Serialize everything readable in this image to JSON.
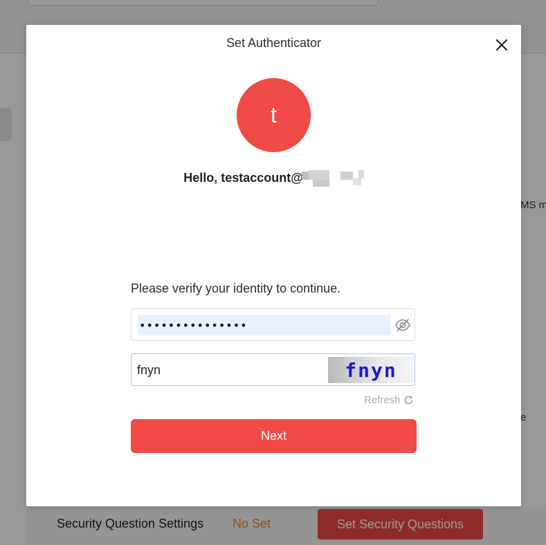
{
  "background": {
    "right_text_1": "MS m",
    "right_text_2": "e",
    "security_question_label": "Security Question Settings",
    "security_question_status": "No Set",
    "security_question_button": "Set Security Questions"
  },
  "modal": {
    "title": "Set Authenticator",
    "close_icon": "close-icon",
    "avatar_letter": "t",
    "greeting": "Hello, testaccount@",
    "verify_prompt": "Please verify your identity to continue.",
    "password": {
      "value": "•••••••••••••••",
      "toggle_icon": "eye-off-icon"
    },
    "captcha": {
      "input_value": "fnyn",
      "image_code": "fnyn"
    },
    "refresh_label": "Refresh",
    "next_label": "Next"
  },
  "colors": {
    "accent": "#ef4a45",
    "warning_text": "#e08a1e",
    "captcha_text": "#1a1acc",
    "password_autofill_bg": "#e8f0fe"
  }
}
